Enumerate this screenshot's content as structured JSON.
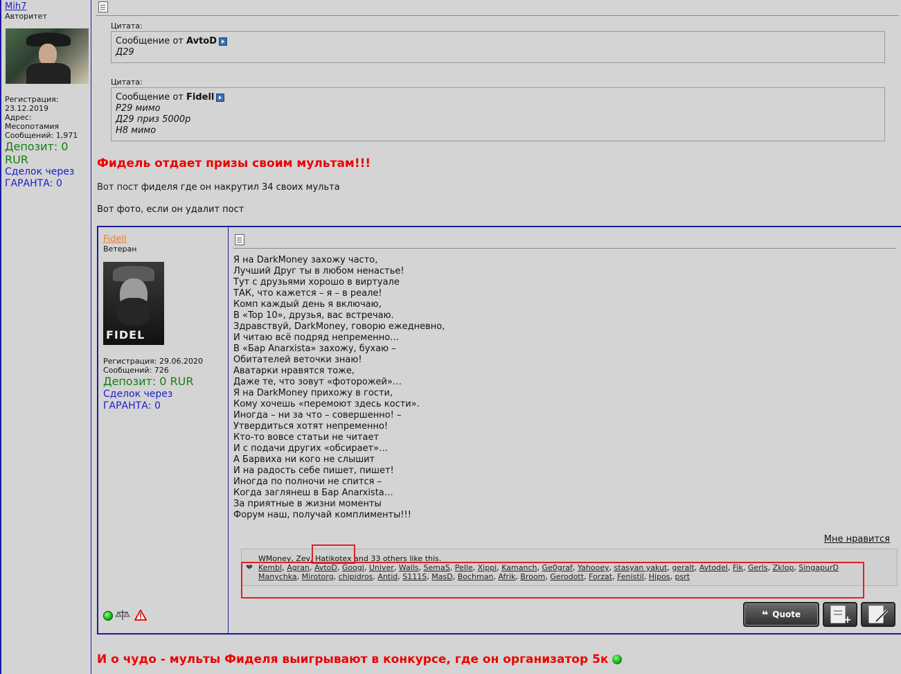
{
  "outer_user": {
    "name": "Mih7",
    "rank": "Авторитет",
    "reg": "Регистрация:",
    "reg_date": "23.12.2019",
    "address": "Адрес: Месопотамия",
    "posts": "Сообщений: 1,971",
    "deposit1": "Депозит: 0",
    "deposit2": "RUR",
    "deals1": "Сделок через",
    "deals2": "ГАРАНТА: 0"
  },
  "quote1": {
    "label": "Цитата:",
    "from_prefix": "Сообщение от",
    "author": "AvtoD",
    "lines": [
      "Д29"
    ]
  },
  "quote2": {
    "label": "Цитата:",
    "from_prefix": "Сообщение от",
    "author": "Fidell",
    "lines": [
      "Р29 мимо",
      "Д29 приз 5000р",
      "Н8 мимо"
    ]
  },
  "headline1": "Фидель отдает призы своим мультам!!!",
  "link_text": "Вот пост",
  "link_rest": " фиделя где он накрутил 34 своих мульта",
  "photo_text": "Вот фото, если он удалит пост",
  "inner_user": {
    "name": "Fidell",
    "rank": "Ветеран",
    "avatar_text": "FIDEL",
    "reg": "Регистрация: 29.06.2020",
    "posts": "Сообщений: 726",
    "deposit": "Депозит: 0 RUR",
    "deals1": "Сделок через",
    "deals2": "ГАРАНТА: 0"
  },
  "poem": "Я на DarkMoney захожу часто,\nЛучший Друг ты в любом ненастье!\nТут с друзьями хорошо в виртуале\nТАК, что кажется – я – в реале!\nКомп каждый день я включаю,\nВ «Top 10», друзья, вас встречаю.\nЗдравствуй, DarkMoney, говорю ежедневно,\nИ читаю всё подряд непременно…\nВ «Бар Anarxista» захожу, бухаю –\nОбитателей веточки знаю!\nАватарки нравятся тоже,\nДаже те, что зовут «фоторожей»…\nЯ на DarkMoney прихожу в гости,\nКому хочешь «перемоют здесь кости».\nИногда – ни за что – совершенно! –\nУтвердиться хотят непременно!\nКто-то вовсе статьи не читает\nИ с подачи других «обсирает»…\nА Барвиха ни кого не слышит\nИ на радость себе пишет, пишет!\nИногда по полночи не спится –\nКогда заглянеш в Бар Anarxista…\nЗа приятные в жизни моменты\nФорум наш, получай комплименты!!!",
  "like_link": "Мне нравится",
  "likes_summary": "WMoney, Zev, Hatikotex and 33 others like this.",
  "likers_row1": [
    "Kembl",
    "Agran",
    "AvtoD",
    "Googi",
    "Univer",
    "Walls",
    "SemaS",
    "Pelle",
    "Xippi",
    "Kamanch",
    "Ge0graf",
    "Yahooey",
    "stasyan yakut",
    "geralt",
    "Avtodel",
    "Fik",
    "Gerls",
    "Zklop",
    "SingapurD"
  ],
  "likers_row2": [
    "Manychka",
    "Mirotorg",
    "chipidros",
    "Antid",
    "S111S",
    "MasD",
    "Bochman",
    "Afrik",
    "Broom",
    "Gerodott",
    "Forzat",
    "Fenistil",
    "Hipos",
    "psrt"
  ],
  "quote_btn": "Quote",
  "headline2": "И о чудо - мульты Фиделя выигрывают в конкурсе, где он организатор 5к",
  "colors": {
    "red": "#ee0000",
    "navy": "#1c1c9a",
    "green": "#108010",
    "blue": "#1a1ad0"
  }
}
